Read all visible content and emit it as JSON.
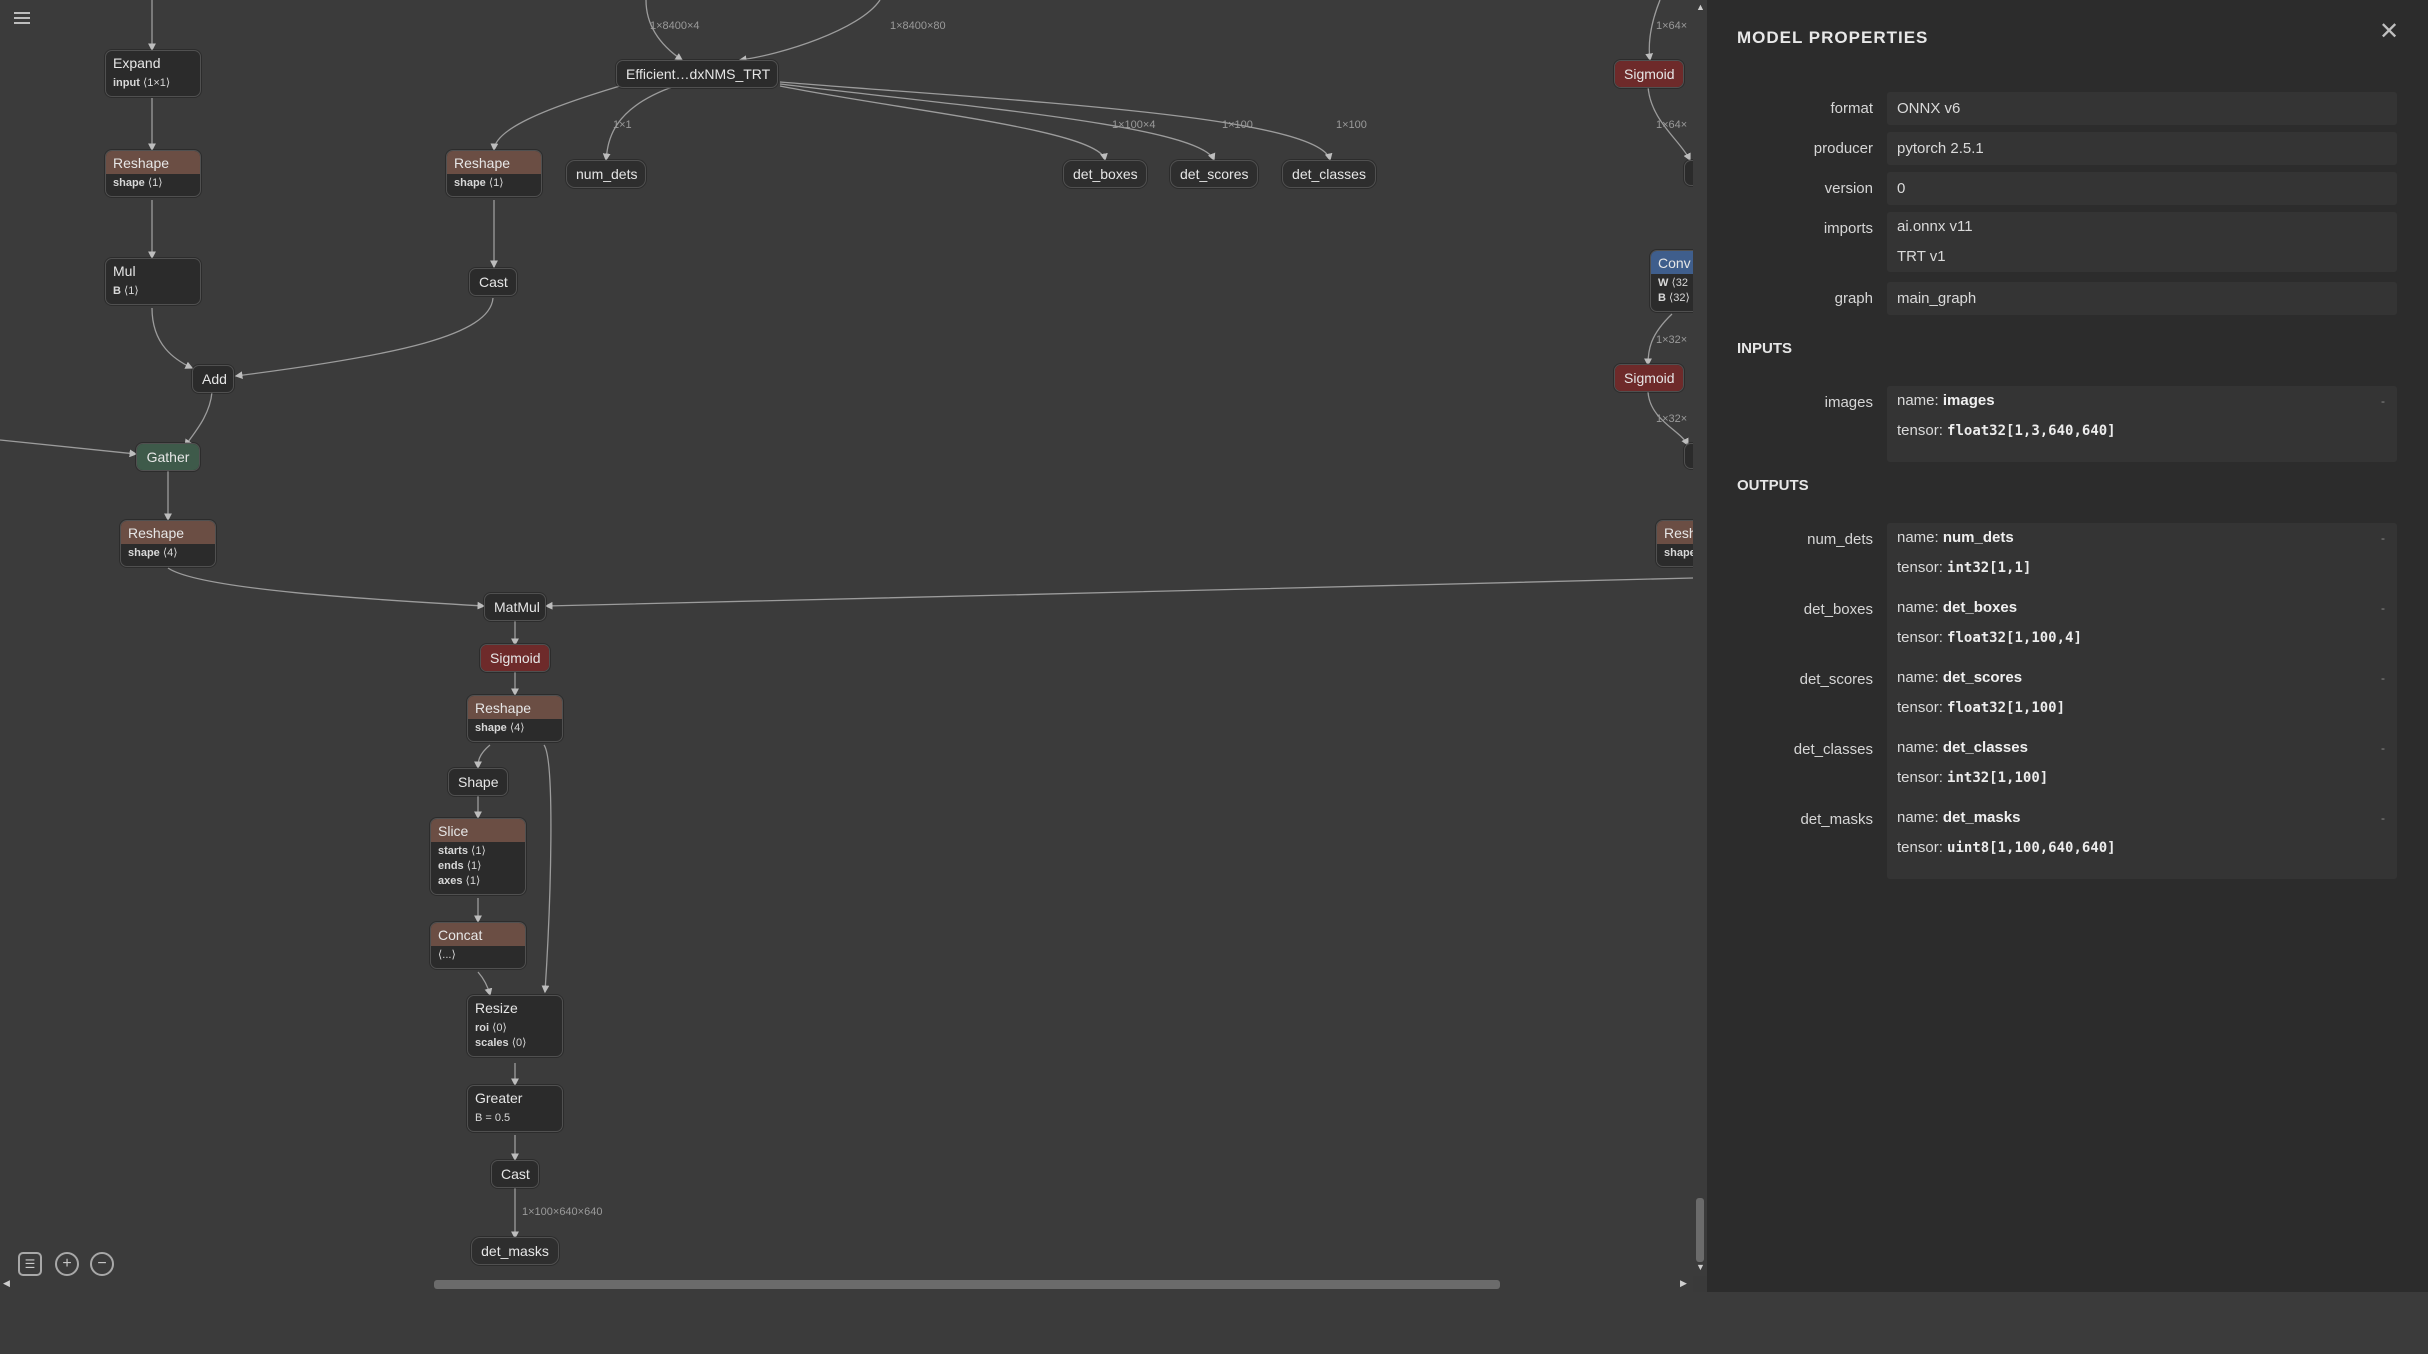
{
  "graph": {
    "nodes": {
      "expand": {
        "title": "Expand",
        "attr": "input",
        "attr_val": "⟨1×1⟩"
      },
      "reshape1": {
        "title": "Reshape",
        "attr": "shape",
        "attr_val": "⟨1⟩"
      },
      "mul": {
        "title": "Mul",
        "attr": "B",
        "attr_val": "⟨1⟩"
      },
      "add": {
        "title": "Add"
      },
      "gather": {
        "title": "Gather"
      },
      "reshape3": {
        "title": "Reshape",
        "attr": "shape",
        "attr_val": "⟨4⟩"
      },
      "nms": {
        "title": "Efficient…dxNMS_TRT"
      },
      "reshape2": {
        "title": "Reshape",
        "attr": "shape",
        "attr_val": "⟨1⟩"
      },
      "cast1": {
        "title": "Cast"
      },
      "num_dets": {
        "title": "num_dets"
      },
      "det_boxes": {
        "title": "det_boxes"
      },
      "det_scores": {
        "title": "det_scores"
      },
      "det_classes": {
        "title": "det_classes"
      },
      "matmul": {
        "title": "MatMul"
      },
      "sigmoid_mid": {
        "title": "Sigmoid"
      },
      "reshape4": {
        "title": "Reshape",
        "attr": "shape",
        "attr_val": "⟨4⟩"
      },
      "shape": {
        "title": "Shape"
      },
      "slice": {
        "title": "Slice",
        "attrs": [
          {
            "k": "starts",
            "v": "⟨1⟩"
          },
          {
            "k": "ends",
            "v": "⟨1⟩"
          },
          {
            "k": "axes",
            "v": "⟨1⟩"
          }
        ]
      },
      "concat": {
        "title": "Concat",
        "attr_val": "⟨...⟩"
      },
      "resize": {
        "title": "Resize",
        "attrs": [
          {
            "k": "roi",
            "v": "⟨0⟩"
          },
          {
            "k": "scales",
            "v": "⟨0⟩"
          }
        ]
      },
      "greater": {
        "title": "Greater",
        "attr_text": "B = 0.5"
      },
      "cast2": {
        "title": "Cast"
      },
      "det_masks": {
        "title": "det_masks"
      },
      "sigmoid_r1": {
        "title": "Sigmoid"
      },
      "conv_r": {
        "title": "Conv",
        "attrs": [
          {
            "k": "W",
            "v": "⟨32"
          },
          {
            "k": "B",
            "v": "⟨32⟩"
          }
        ]
      },
      "sigmoid_r2": {
        "title": "Sigmoid"
      },
      "reshape_r": {
        "title": "Resh",
        "attr": "shape",
        "attr_val": ""
      }
    },
    "edge_labels": {
      "e1": "1×8400×4",
      "e2": "1×8400×80",
      "e3": "1×1",
      "e4": "1×100×4",
      "e5": "1×100",
      "e6": "1×100",
      "e7": "1×100×640×640",
      "e8": "1×64×",
      "e9": "1×64×",
      "e10": "1×32×",
      "e11": "1×32×"
    }
  },
  "toolbar": {
    "menu_icon": "hamburger-icon",
    "list_icon": "list-icon",
    "zoom_in": "+",
    "zoom_out": "−"
  },
  "sidebar": {
    "title": "MODEL PROPERTIES",
    "close": "✕",
    "props": [
      {
        "label": "format",
        "value": "ONNX v6"
      },
      {
        "label": "producer",
        "value": "pytorch 2.5.1"
      },
      {
        "label": "version",
        "value": "0"
      },
      {
        "label": "imports",
        "values": [
          "ai.onnx v11",
          "TRT v1"
        ]
      },
      {
        "label": "graph",
        "value": "main_graph"
      }
    ],
    "inputs_title": "INPUTS",
    "inputs": [
      {
        "label": "images",
        "name": "images",
        "tensor": "float32[1,3,640,640]"
      }
    ],
    "outputs_title": "OUTPUTS",
    "outputs": [
      {
        "label": "num_dets",
        "name": "num_dets",
        "tensor": "int32[1,1]"
      },
      {
        "label": "det_boxes",
        "name": "det_boxes",
        "tensor": "float32[1,100,4]"
      },
      {
        "label": "det_scores",
        "name": "det_scores",
        "tensor": "float32[1,100]"
      },
      {
        "label": "det_classes",
        "name": "det_classes",
        "tensor": "int32[1,100]"
      },
      {
        "label": "det_masks",
        "name": "det_masks",
        "tensor": "uint8[1,100,640,640]"
      }
    ],
    "name_prefix": "name: ",
    "tensor_prefix": "tensor: ",
    "dash": "-"
  }
}
